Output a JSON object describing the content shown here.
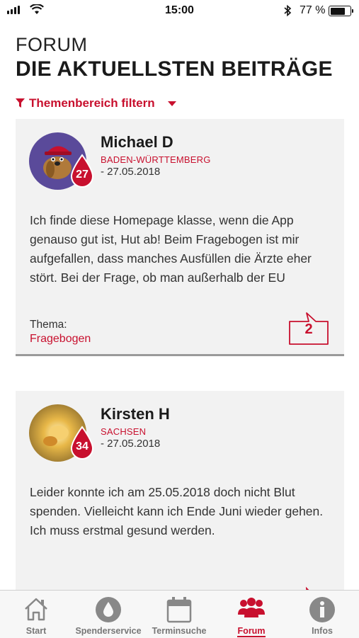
{
  "status": {
    "time": "15:00",
    "battery": "77 %",
    "battery_level": 0.77
  },
  "header": {
    "sub": "FORUM",
    "title": "DIE AKTUELLSTEN BEITRÄGE"
  },
  "filter": {
    "label": "Themenbereich filtern"
  },
  "posts": [
    {
      "name": "Michael D",
      "region": "BADEN-WÜRTTEMBERG",
      "date": "- 27.05.2018",
      "badge": "27",
      "text": "Ich finde diese Homepage klasse, wenn die App genauso gut ist, Hut ab! Beim Fragebogen ist mir aufgefallen, dass manches Ausfüllen die Ärzte eher stört. Bei der Frage, ob man außerhalb der EU",
      "thema_label": "Thema:",
      "thema": "Fragebogen",
      "comments": "2"
    },
    {
      "name": "Kirsten H",
      "region": "SACHSEN",
      "date": "- 27.05.2018",
      "badge": "34",
      "text": "Leider konnte ich am 25.05.2018 doch nicht Blut spenden. Vielleicht kann ich Ende Juni wieder gehen. Ich muss erstmal gesund werden."
    }
  ],
  "tabs": [
    {
      "label": "Start",
      "icon": "home-icon"
    },
    {
      "label": "Spenderservice",
      "icon": "drop-icon"
    },
    {
      "label": "Terminsuche",
      "icon": "calendar-icon"
    },
    {
      "label": "Forum",
      "icon": "group-icon",
      "active": true
    },
    {
      "label": "Infos",
      "icon": "info-icon"
    }
  ],
  "colors": {
    "accent": "#c8102e",
    "card": "#f2f2f2",
    "tab_inactive": "#777777"
  }
}
